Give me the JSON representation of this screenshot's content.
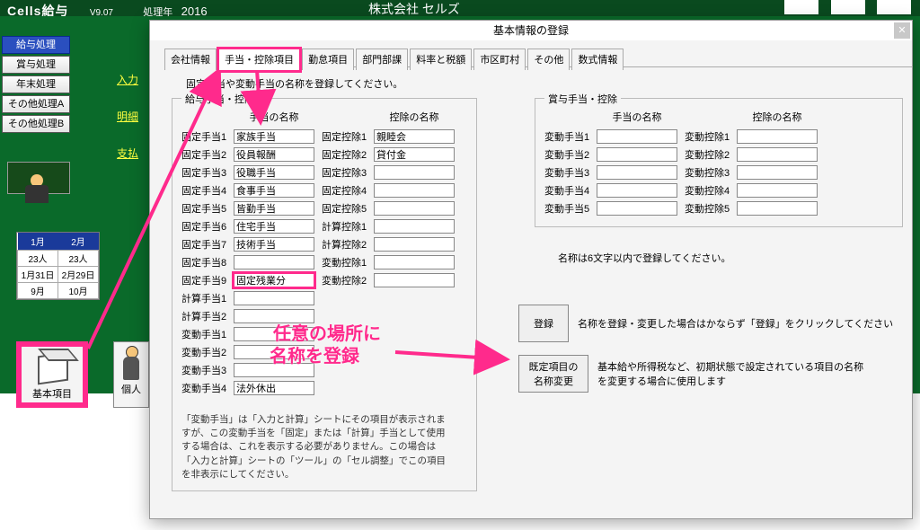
{
  "domain": "Computer-Use",
  "app": {
    "title": "Cells給与",
    "version": "V9.07",
    "year_label": "処理年",
    "year": "2016",
    "company": "株式会社 セルズ"
  },
  "sidebar": [
    {
      "label": "給与処理",
      "active": true
    },
    {
      "label": "賞与処理"
    },
    {
      "label": "年末処理"
    },
    {
      "label": "その他処理A"
    },
    {
      "label": "その他処理B"
    }
  ],
  "yellow_links": [
    "入力",
    "明細",
    "支払"
  ],
  "calendar": {
    "head1": [
      "1月",
      "2月"
    ],
    "r1": [
      "23人",
      "23人"
    ],
    "r2": [
      "1月31日",
      "2月29日"
    ],
    "r3": [
      "9月",
      "10月"
    ]
  },
  "big_buttons": {
    "basic": "基本項目",
    "personal": "個人"
  },
  "dialog": {
    "title": "基本情報の登録",
    "tabs": [
      "会社情報",
      "手当・控除項目",
      "勤怠項目",
      "部門部課",
      "料率と税額",
      "市区町村",
      "その他",
      "数式情報"
    ],
    "active_tab": 1,
    "hint": "固定手当や変動手当の名称を登録してください。",
    "left_legend": "給与手当・控除",
    "right_legend": "賞与手当・控除",
    "col_allow": "手当の名称",
    "col_deduct": "控除の名称",
    "salary_allow": [
      {
        "lbl": "固定手当1",
        "val": "家族手当"
      },
      {
        "lbl": "固定手当2",
        "val": "役員報酬"
      },
      {
        "lbl": "固定手当3",
        "val": "役職手当"
      },
      {
        "lbl": "固定手当4",
        "val": "食事手当"
      },
      {
        "lbl": "固定手当5",
        "val": "皆勤手当"
      },
      {
        "lbl": "固定手当6",
        "val": "住宅手当"
      },
      {
        "lbl": "固定手当7",
        "val": "技術手当"
      },
      {
        "lbl": "固定手当8",
        "val": ""
      },
      {
        "lbl": "固定手当9",
        "val": "固定残業分",
        "hl": true
      },
      {
        "lbl": "計算手当1",
        "val": ""
      },
      {
        "lbl": "計算手当2",
        "val": ""
      },
      {
        "lbl": "変動手当1",
        "val": ""
      },
      {
        "lbl": "変動手当2",
        "val": ""
      },
      {
        "lbl": "変動手当3",
        "val": ""
      },
      {
        "lbl": "変動手当4",
        "val": "法外休出"
      }
    ],
    "salary_deduct": [
      {
        "lbl": "固定控除1",
        "val": "親睦会"
      },
      {
        "lbl": "固定控除2",
        "val": "貸付金"
      },
      {
        "lbl": "固定控除3",
        "val": ""
      },
      {
        "lbl": "固定控除4",
        "val": ""
      },
      {
        "lbl": "固定控除5",
        "val": ""
      },
      {
        "lbl": "計算控除1",
        "val": ""
      },
      {
        "lbl": "計算控除2",
        "val": ""
      },
      {
        "lbl": "変動控除1",
        "val": ""
      },
      {
        "lbl": "変動控除2",
        "val": ""
      }
    ],
    "bonus_allow": [
      {
        "lbl": "変動手当1",
        "val": ""
      },
      {
        "lbl": "変動手当2",
        "val": ""
      },
      {
        "lbl": "変動手当3",
        "val": ""
      },
      {
        "lbl": "変動手当4",
        "val": ""
      },
      {
        "lbl": "変動手当5",
        "val": ""
      }
    ],
    "bonus_deduct": [
      {
        "lbl": "変動控除1",
        "val": ""
      },
      {
        "lbl": "変動控除2",
        "val": ""
      },
      {
        "lbl": "変動控除3",
        "val": ""
      },
      {
        "lbl": "変動控除4",
        "val": ""
      },
      {
        "lbl": "変動控除5",
        "val": ""
      }
    ],
    "limit_note": "名称は6文字以内で登録してください。",
    "register": "登録",
    "register_note": "名称を登録・変更した場合はかならず「登録」をクリックしてください",
    "rename_btn": "既定項目の\n名称変更",
    "rename_note": "基本給や所得税など、初期状態で設定されている項目の名称を変更する場合に使用します",
    "footer": "「変動手当」は「入力と計算」シートにその項目が表示されますが、この変動手当を「固定」または「計算」手当として使用する場合は、これを表示する必要がありません。この場合は「入力と計算」シートの「ツール」の「セル調整」でこの項目を非表示にしてください。"
  },
  "annotation": {
    "l1": "任意の場所に",
    "l2": "名称を登録"
  }
}
